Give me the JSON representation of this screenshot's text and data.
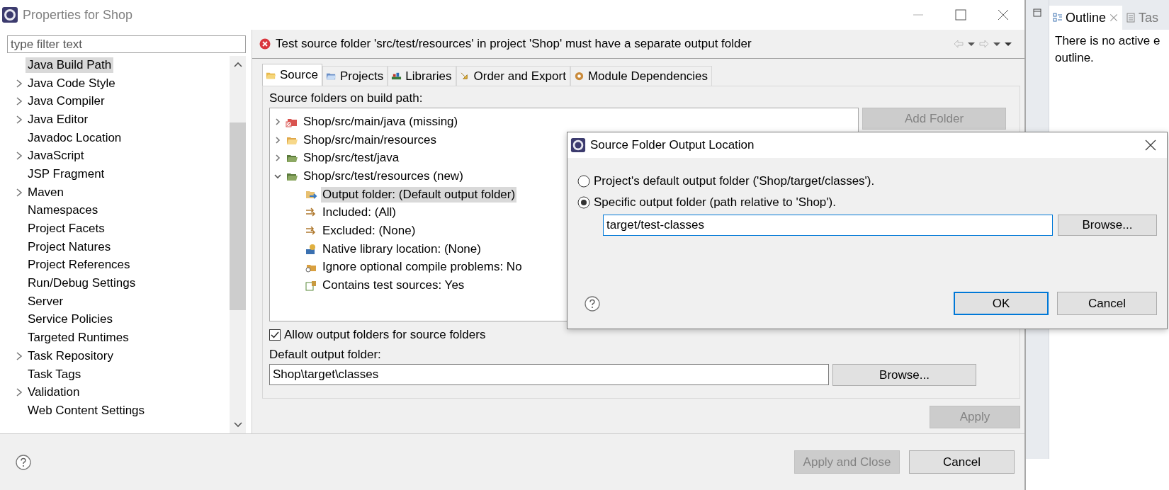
{
  "window": {
    "title": "Properties for Shop"
  },
  "filter": {
    "placeholder": "type filter text"
  },
  "nav": {
    "items": [
      {
        "label": "Java Build Path",
        "expandable": false,
        "selected": true
      },
      {
        "label": "Java Code Style",
        "expandable": true,
        "selected": false
      },
      {
        "label": "Java Compiler",
        "expandable": true,
        "selected": false
      },
      {
        "label": "Java Editor",
        "expandable": true,
        "selected": false
      },
      {
        "label": "Javadoc Location",
        "expandable": false,
        "selected": false
      },
      {
        "label": "JavaScript",
        "expandable": true,
        "selected": false
      },
      {
        "label": "JSP Fragment",
        "expandable": false,
        "selected": false
      },
      {
        "label": "Maven",
        "expandable": true,
        "selected": false
      },
      {
        "label": "Namespaces",
        "expandable": false,
        "selected": false
      },
      {
        "label": "Project Facets",
        "expandable": false,
        "selected": false
      },
      {
        "label": "Project Natures",
        "expandable": false,
        "selected": false
      },
      {
        "label": "Project References",
        "expandable": false,
        "selected": false
      },
      {
        "label": "Run/Debug Settings",
        "expandable": false,
        "selected": false
      },
      {
        "label": "Server",
        "expandable": false,
        "selected": false
      },
      {
        "label": "Service Policies",
        "expandable": false,
        "selected": false
      },
      {
        "label": "Targeted Runtimes",
        "expandable": false,
        "selected": false
      },
      {
        "label": "Task Repository",
        "expandable": true,
        "selected": false
      },
      {
        "label": "Task Tags",
        "expandable": false,
        "selected": false
      },
      {
        "label": "Validation",
        "expandable": true,
        "selected": false
      },
      {
        "label": "Web Content Settings",
        "expandable": false,
        "selected": false
      }
    ]
  },
  "error": {
    "message": "Test source folder 'src/test/resources' in project 'Shop' must have a separate output folder"
  },
  "tabs": [
    {
      "label": "Source",
      "kind": "source",
      "selected": true
    },
    {
      "label": "Projects",
      "kind": "projects",
      "selected": false
    },
    {
      "label": "Libraries",
      "kind": "libraries",
      "selected": false
    },
    {
      "label": "Order and Export",
      "kind": "order",
      "selected": false
    },
    {
      "label": "Module Dependencies",
      "kind": "module",
      "selected": false
    }
  ],
  "source_folders": {
    "label": "Source folders on build path:",
    "tree": [
      {
        "label": "Shop/src/main/java (missing)",
        "kind": "missing",
        "expanded": false
      },
      {
        "label": "Shop/src/main/resources",
        "kind": "resources",
        "expanded": false
      },
      {
        "label": "Shop/src/test/java",
        "kind": "package",
        "expanded": false
      },
      {
        "label": "Shop/src/test/resources (new)",
        "kind": "package",
        "expanded": true,
        "children": [
          {
            "label": "Output folder: (Default output folder)",
            "kind": "output",
            "selected": true
          },
          {
            "label": "Included: (All)",
            "kind": "filter",
            "selected": false
          },
          {
            "label": "Excluded: (None)",
            "kind": "filter",
            "selected": false
          },
          {
            "label": "Native library location: (None)",
            "kind": "native",
            "selected": false
          },
          {
            "label": "Ignore optional compile problems: No",
            "kind": "compile",
            "selected": false
          },
          {
            "label": "Contains test sources: Yes",
            "kind": "test",
            "selected": false
          }
        ]
      }
    ]
  },
  "side_buttons": [
    {
      "label": "Add Folder",
      "disabled": true
    }
  ],
  "allow_output": {
    "label": "Allow output folders for source folders",
    "checked": true
  },
  "default_output": {
    "label": "Default output folder:",
    "value": "Shop\\target\\classes",
    "button": "Browse..."
  },
  "apply": {
    "label": "Apply",
    "disabled": true
  },
  "footer": {
    "buttons": [
      {
        "label": "Apply and Close",
        "disabled": true
      },
      {
        "label": "Cancel",
        "disabled": false
      }
    ]
  },
  "outline": {
    "tabs": [
      {
        "label": "Outline",
        "selected": true
      },
      {
        "label": "Tas",
        "selected": false
      }
    ],
    "lines": [
      "There is no active e",
      "outline."
    ]
  },
  "dialog": {
    "title": "Source Folder Output Location",
    "options": [
      {
        "label": "Project's default output folder ('Shop/target/classes').",
        "selected": false
      },
      {
        "label": "Specific output folder (path relative to 'Shop').",
        "selected": true
      }
    ],
    "path": "target/test-classes",
    "browse": "Browse...",
    "buttons": [
      {
        "label": "OK",
        "default": true
      },
      {
        "label": "Cancel",
        "default": false
      }
    ]
  }
}
